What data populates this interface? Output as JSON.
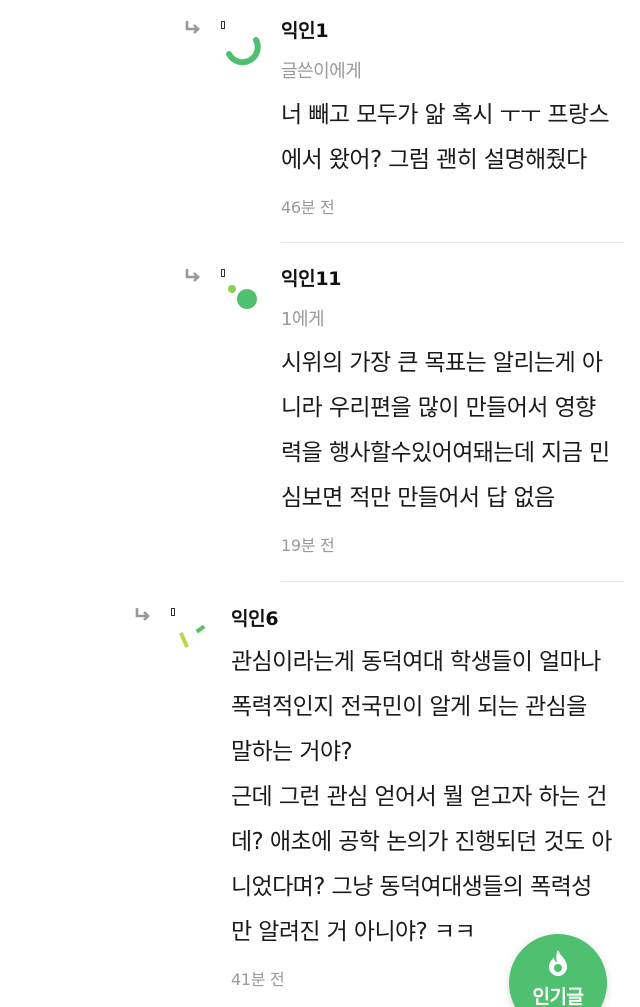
{
  "comments": [
    {
      "author": "익인1",
      "target": "글쓴이에게",
      "body": "너 빼고 모두가 앎 혹시 ㅜㅜ 프랑스\n에서 왔어? 그럼 괜히 설명해줬다",
      "time": "46분 전"
    },
    {
      "author": "익인11",
      "target": "1에게",
      "body": "시위의 가장 큰 목표는 알리는게 아\n니라 우리편을 많이 만들어서 영향\n력을 행사할수있어여돼는데 지금 민\n심보면 적만 만들어서 답 없음",
      "time": "19분 전"
    },
    {
      "author": "익인6",
      "body": "관심이라는게 동덕여대 학생들이 얼마나\n폭력적인지 전국민이 알게 되는 관심을\n말하는 거야?\n근데 그런 관심 얻어서 뭘 얻고자 하는 건\n데? 애초에 공학 논의가 진행되던 것도 아\n니었다며? 그냥 동덕여대생들의 폭력성\n만 알려진 거 아니야? ㅋㅋ",
      "time": "41분 전"
    }
  ],
  "fab": {
    "label": "인기글",
    "icon": "flame-icon",
    "color": "#4fc06f"
  },
  "colors": {
    "accent_green": "#4fc06f",
    "secondary_text": "#9a9a9a",
    "divider": "#e7e7e7"
  }
}
